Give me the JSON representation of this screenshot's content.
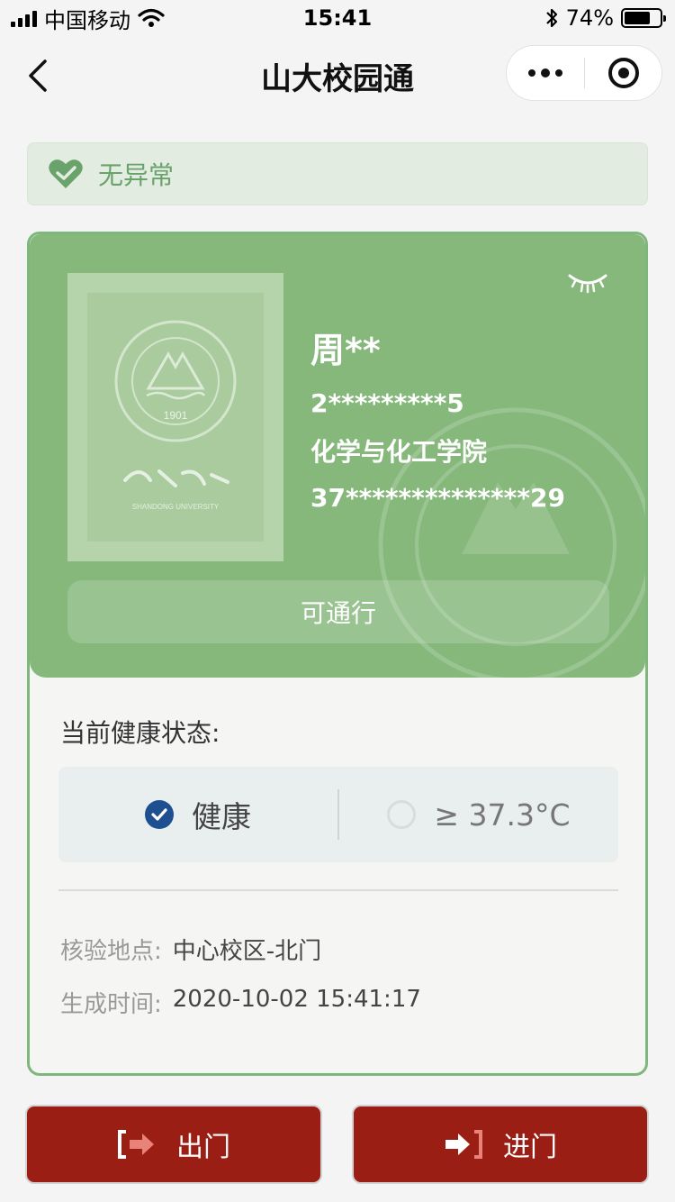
{
  "status_bar": {
    "carrier": "中国移动",
    "time": "15:41",
    "battery": "74%",
    "battery_level": 0.74
  },
  "nav": {
    "title": "山大校园通"
  },
  "banner": {
    "text": "无异常"
  },
  "profile": {
    "name": "周**",
    "student_id": "2*********5",
    "college": "化学与化工学院",
    "id_card": "37**************29",
    "pass_label": "可通行",
    "seal_year": "1901",
    "seal_text": "SHANDONG UNIVERSITY"
  },
  "health": {
    "title": "当前健康状态:",
    "options": [
      {
        "label": "健康",
        "selected": true
      },
      {
        "label": "≥ 37.3°C",
        "selected": false
      }
    ]
  },
  "meta": {
    "location_label": "核验地点:",
    "location_value": "中心校区-北门",
    "time_label": "生成时间:",
    "time_value": "2020-10-02 15:41:17"
  },
  "actions": {
    "exit_label": "出门",
    "enter_label": "进门"
  },
  "colors": {
    "card_green": "#86b87c",
    "button_red": "#9b1e15",
    "check_blue": "#1e4f91",
    "banner_green": "#6aa26b"
  }
}
